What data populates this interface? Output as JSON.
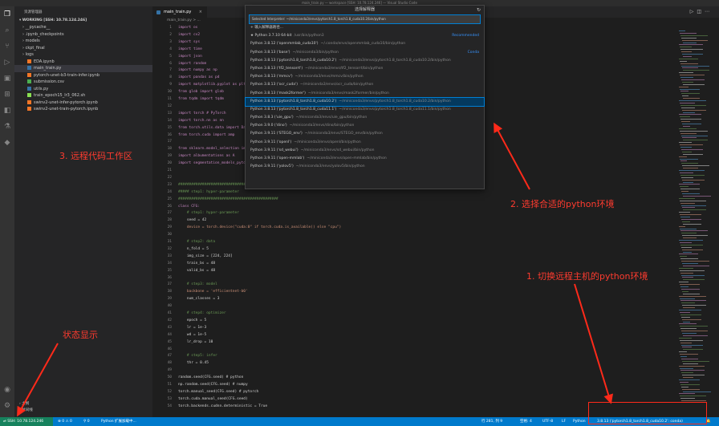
{
  "window": {
    "title": "main_train.py — workspace [SSH: 10.78.124.246] — Visual Studio Code"
  },
  "explorer": {
    "header": "资源管理器",
    "workspace": "WORKING [SSH: 10.78.124.246]",
    "items": [
      {
        "label": "__pycache__",
        "type": "folder"
      },
      {
        "label": ".ipynb_checkpoints",
        "type": "folder"
      },
      {
        "label": "models",
        "type": "folder"
      },
      {
        "label": "ckpt_final",
        "type": "folder"
      },
      {
        "label": "logs",
        "type": "folder"
      },
      {
        "label": "EDA.ipynb",
        "type": "notebook"
      },
      {
        "label": "main_train.py",
        "type": "python"
      },
      {
        "label": "pytorch-unet-b3-train-infer.ipynb",
        "type": "notebook"
      },
      {
        "label": "submission.csv",
        "type": "csv"
      },
      {
        "label": "utils.py",
        "type": "python"
      },
      {
        "label": "train_epoch15_lr3_062.sh",
        "type": "shell"
      },
      {
        "label": "swinv2-unet-infer-pytorch.ipynb",
        "type": "notebook"
      },
      {
        "label": "swinv2-unet-train-pytorch.ipynb",
        "type": "notebook"
      }
    ],
    "outline_label": "大纲",
    "timeline_label": "时间线"
  },
  "editor": {
    "tab_label": "main_train.py",
    "breadcrumb": "main_train.py > ...",
    "lines": [
      {
        "n": "1",
        "text": "import os"
      },
      {
        "n": "2",
        "text": "import cv2"
      },
      {
        "n": "3",
        "text": "import sys"
      },
      {
        "n": "4",
        "text": "import time"
      },
      {
        "n": "5",
        "text": "import json"
      },
      {
        "n": "6",
        "text": "import random"
      },
      {
        "n": "7",
        "text": "import numpy as np"
      },
      {
        "n": "8",
        "text": "import pandas as pd"
      },
      {
        "n": "9",
        "text": "import matplotlib.pyplot as plt"
      },
      {
        "n": "10",
        "text": "from glob import glob"
      },
      {
        "n": "11",
        "text": "from tqdm import tqdm"
      },
      {
        "n": "12",
        "text": ""
      },
      {
        "n": "13",
        "text": "import torch # PyTorch"
      },
      {
        "n": "14",
        "text": "import torch.nn as nn"
      },
      {
        "n": "15",
        "text": "from torch.utils.data import Dataset, DataLoader"
      },
      {
        "n": "16",
        "text": "from torch.cuda import amp"
      },
      {
        "n": "17",
        "text": ""
      },
      {
        "n": "18",
        "text": "from sklearn.model_selection import StratifiedGroupKFold"
      },
      {
        "n": "19",
        "text": "import albumentations as A"
      },
      {
        "n": "20",
        "text": "import segmentation_models_pytorch as smp"
      },
      {
        "n": "21",
        "text": ""
      },
      {
        "n": "22",
        "text": ""
      },
      {
        "n": "23",
        "text": "##############################################"
      },
      {
        "n": "24",
        "text": "##### step1: hyper-parameter"
      },
      {
        "n": "25",
        "text": "##############################################"
      },
      {
        "n": "26",
        "text": "class CFG:"
      },
      {
        "n": "27",
        "text": "    # step1: hyper-parameter"
      },
      {
        "n": "28",
        "text": "    seed = 42"
      },
      {
        "n": "29",
        "text": "    device = torch.device(\"cuda:0\" if torch.cuda.is_available() else \"cpu\")"
      },
      {
        "n": "30",
        "text": ""
      },
      {
        "n": "31",
        "text": "    # step2: data"
      },
      {
        "n": "32",
        "text": "    n_fold = 5"
      },
      {
        "n": "33",
        "text": "    img_size = [224, 224]"
      },
      {
        "n": "34",
        "text": "    train_bs = 48"
      },
      {
        "n": "35",
        "text": "    valid_bs = 48"
      },
      {
        "n": "36",
        "text": ""
      },
      {
        "n": "37",
        "text": "    # step3: model"
      },
      {
        "n": "38",
        "text": "    backbone = 'efficientnet-b0'"
      },
      {
        "n": "39",
        "text": "    num_classes = 3"
      },
      {
        "n": "40",
        "text": ""
      },
      {
        "n": "41",
        "text": "    # step4: optimizer"
      },
      {
        "n": "42",
        "text": "    epoch = 5"
      },
      {
        "n": "43",
        "text": "    lr = 1e-3"
      },
      {
        "n": "44",
        "text": "    wd = 1e-5"
      },
      {
        "n": "45",
        "text": "    lr_drop = 10"
      },
      {
        "n": "46",
        "text": ""
      },
      {
        "n": "47",
        "text": "    # step5: infer"
      },
      {
        "n": "48",
        "text": "    thr = 0.45"
      },
      {
        "n": "49",
        "text": ""
      },
      {
        "n": "50",
        "text": "random.seed(CFG.seed) # python"
      },
      {
        "n": "51",
        "text": "np.random.seed(CFG.seed) # numpy"
      },
      {
        "n": "52",
        "text": "torch.manual_seed(CFG.seed) # pytorch"
      },
      {
        "n": "53",
        "text": "torch.cuda.manual_seed(CFG.seed)"
      },
      {
        "n": "54",
        "text": "torch.backends.cudnn.deterministic = True"
      }
    ]
  },
  "picker": {
    "title": "选择解释器",
    "input_value": "Selected Interpreter: ~/miniconda3/envs/pytorch1.8_torch1.8_cuda10.2/bin/python",
    "items": [
      {
        "label": "+ 输入解释器路径...",
        "path": "",
        "tag": ""
      },
      {
        "label": "★ Python 3.7.10 64-bit",
        "path": "/usr/bin/python3",
        "tag": "Recommended"
      },
      {
        "label": "Python 3.8.12 ('openmmlab_cuda10')",
        "path": "~/.conda/envs/openmmlab_cuda10/bin/python",
        "tag": ""
      },
      {
        "label": "Python 3.8.13 ('base')",
        "path": "~/miniconda3/bin/python",
        "tag": "Conda"
      },
      {
        "label": "Python 3.8.13 ('pytorch1.8_torch1.8_cuda10.2')",
        "path": "~/miniconda3/envs/pytorch1.8_torch1.8_cuda10.2/bin/python",
        "tag": ""
      },
      {
        "label": "Python 3.8.13 ('tf2_tensorrt')",
        "path": "~/miniconda3/envs/tf2_tensorrt/bin/python",
        "tag": ""
      },
      {
        "label": "Python 3.8.13 ('mmcv')",
        "path": "~/miniconda3/envs/mmcv/bin/python",
        "tag": ""
      },
      {
        "label": "Python 3.8.13 ('ocr_cuda')",
        "path": "~/miniconda3/envs/ocr_cuda/bin/python",
        "tag": ""
      },
      {
        "label": "Python 3.8.13 ('mask2former')",
        "path": "~/miniconda3/envs/mask2former/bin/python",
        "tag": ""
      },
      {
        "label": "Python 3.8.13 ('pytorch1.8_torch1.8_cuda10.2')",
        "path": "~/miniconda3/envs/pytorch1.8_torch1.8_cuda10.2/bin/python",
        "tag": ""
      },
      {
        "label": "Python 3.8.13 ('pytorch1.8_torch1.8_cuda11.1')",
        "path": "~/miniconda3/envs/pytorch1.8_torch1.8_cuda11.1/bin/python",
        "tag": ""
      },
      {
        "label": "Python 3.8.3 ('uie_gpu')",
        "path": "~/miniconda3/envs/uie_gpu/bin/python",
        "tag": ""
      },
      {
        "label": "Python 3.9.0 ('dino')",
        "path": "~/miniconda3/envs/dino/bin/python",
        "tag": ""
      },
      {
        "label": "Python 3.9.11 ('STEGO_env')",
        "path": "~/miniconda3/envs/STEGO_env/bin/python",
        "tag": ""
      },
      {
        "label": "Python 3.9.11 ('openl')",
        "path": "~/miniconda3/envs/openl/bin/python",
        "tag": ""
      },
      {
        "label": "Python 3.9.11 ('sd_webui')",
        "path": "~/miniconda3/envs/sd_webui/bin/python",
        "tag": ""
      },
      {
        "label": "Python 3.9.11 ('open-mmlab')",
        "path": "~/miniconda3/envs/open-mmlab/bin/python",
        "tag": ""
      },
      {
        "label": "Python 3.9.11 ('yolov5')",
        "path": "~/miniconda3/envs/yolov5/bin/python",
        "tag": ""
      }
    ],
    "selected_index": 9
  },
  "statusbar": {
    "remote": "SSH: 10.78.124.246",
    "problems": "⊗ 0 ⚠ 0",
    "ports": "⚲ 0",
    "python_ext": "Python 扩展加载中...",
    "position": "行 281, 列 9",
    "spaces": "空格: 4",
    "encoding": "UTF-8",
    "eol": "LF",
    "language": "Python",
    "interpreter": "3.8.13 ('pytorch1.8_torch1.8_cuda10.2': conda)"
  },
  "annotations": {
    "remote_workspace": "3. 远程代码工作区",
    "choose_env": "2. 选择合适的python环境",
    "switch_remote": "1. 切换远程主机的python环境",
    "status_display": "状态显示"
  },
  "colors": {
    "accent": "#007acc",
    "annotation": "#ff3b2f",
    "keyword": "#c586c0",
    "comment": "#6a9955",
    "string": "#ce9178"
  }
}
